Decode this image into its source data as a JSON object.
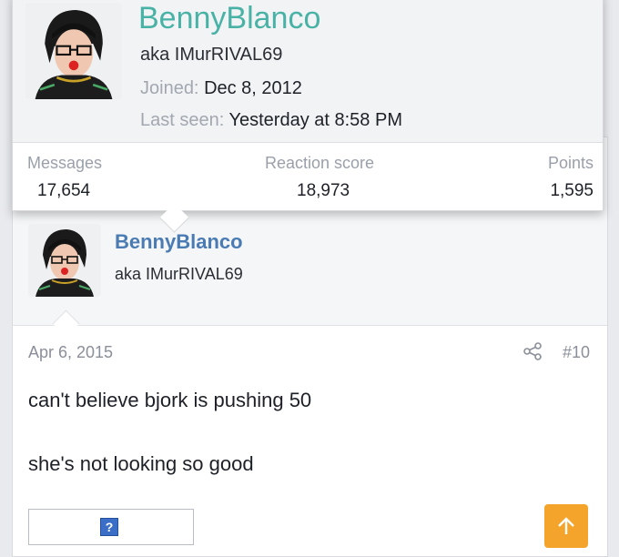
{
  "profile_card": {
    "username": "BennyBlanco",
    "aka": "aka IMurRIVAL69",
    "joined_label": "Joined:",
    "joined_value": "Dec 8, 2012",
    "last_seen_label": "Last seen:",
    "last_seen_value": "Yesterday at 8:58 PM",
    "stats": [
      {
        "label": "Messages",
        "value": "17,654"
      },
      {
        "label": "Reaction score",
        "value": "18,973"
      },
      {
        "label": "Points",
        "value": "1,595"
      }
    ]
  },
  "post": {
    "username": "BennyBlanco",
    "aka": "aka IMurRIVAL69",
    "date": "Apr 6, 2015",
    "number": "#10",
    "body_line1": "can't believe bjork is pushing 50",
    "body_line2": "she's not looking so good",
    "embed_icon": "?"
  },
  "icons": {
    "share": "share-icon",
    "scroll_top": "arrow-up-icon"
  },
  "colors": {
    "card_username": "#49b2a6",
    "post_username": "#4a7bb3",
    "scroll_button": "#f4a42a"
  }
}
